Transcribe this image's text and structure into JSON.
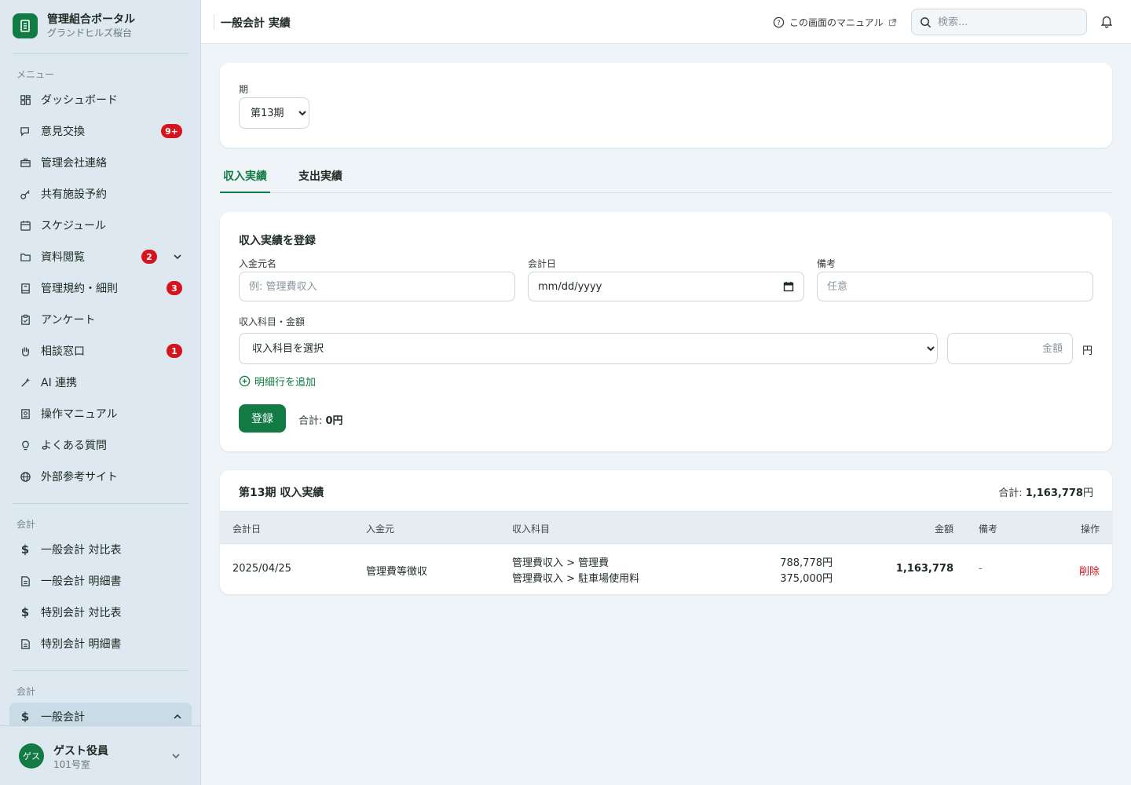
{
  "sidebar": {
    "brand_title": "管理組合ポータル",
    "brand_sub": "グランドヒルズ桜台",
    "menu_label": "メニュー",
    "items": [
      {
        "label": "ダッシュボード",
        "icon": "dashboard-icon"
      },
      {
        "label": "意見交換",
        "icon": "chat-icon",
        "badge": "9+"
      },
      {
        "label": "管理会社連絡",
        "icon": "briefcase-icon"
      },
      {
        "label": "共有施設予約",
        "icon": "key-icon"
      },
      {
        "label": "スケジュール",
        "icon": "calendar-icon"
      },
      {
        "label": "資料閲覧",
        "icon": "folder-icon",
        "badge": "2",
        "has_chevron": true
      },
      {
        "label": "管理規約・細則",
        "icon": "book-icon",
        "badge": "3"
      },
      {
        "label": "アンケート",
        "icon": "clipboard-icon"
      },
      {
        "label": "相談窓口",
        "icon": "hand-icon",
        "badge": "1"
      },
      {
        "label": "AI 連携",
        "icon": "sparkle-icon"
      },
      {
        "label": "操作マニュアル",
        "icon": "manual-icon"
      },
      {
        "label": "よくある質問",
        "icon": "lightbulb-icon"
      },
      {
        "label": "外部参考サイト",
        "icon": "globe-icon"
      }
    ],
    "accounting_label": "会計",
    "accounting_items": [
      {
        "label": "一般会計 対比表",
        "icon": "dollar-icon"
      },
      {
        "label": "一般会計 明細書",
        "icon": "document-icon"
      },
      {
        "label": "特別会計 対比表",
        "icon": "dollar-icon"
      },
      {
        "label": "特別会計 明細書",
        "icon": "document-icon"
      }
    ],
    "accounting2_label": "会計",
    "active_item": "一般会計",
    "user_avatar": "ゲス",
    "user_name": "ゲスト役員",
    "user_room": "101号室"
  },
  "header": {
    "title": "一般会計 実績",
    "manual_link": "この画面のマニュアル",
    "search_placeholder": "検索..."
  },
  "period": {
    "label": "期",
    "selected": "第13期"
  },
  "tabs": [
    "収入実績",
    "支出実績"
  ],
  "form": {
    "title": "収入実績を登録",
    "payer_label": "入金元名",
    "payer_placeholder": "例: 管理費収入",
    "date_label": "会計日",
    "date_placeholder": "mm/dd/yyyy",
    "note_label": "備考",
    "note_placeholder": "任意",
    "category_label": "収入科目・金額",
    "category_selected": "収入科目を選択",
    "amount_placeholder": "金額",
    "currency": "円",
    "add_line": "明細行を追加",
    "submit": "登録",
    "total_prefix": "合計: ",
    "total_value": "0円"
  },
  "table": {
    "title": "第13期 収入実績",
    "total_prefix": "合計: ",
    "total_value": "1,163,778",
    "total_suffix": "円",
    "headers": [
      "会計日",
      "入金元",
      "収入科目",
      "金額",
      "備考",
      "操作"
    ],
    "rows": [
      {
        "date": "2025/04/25",
        "payer": "管理費等徴収",
        "category_1": "管理費収入 > 管理費",
        "category_2": "管理費収入 > 駐車場使用料",
        "amount_1": "788,778円",
        "amount_2": "375,000円",
        "amount_total": "1,163,778",
        "note": "-",
        "action": "削除"
      }
    ]
  },
  "colors": {
    "accent": "#127a43",
    "danger": "#d6141e"
  }
}
